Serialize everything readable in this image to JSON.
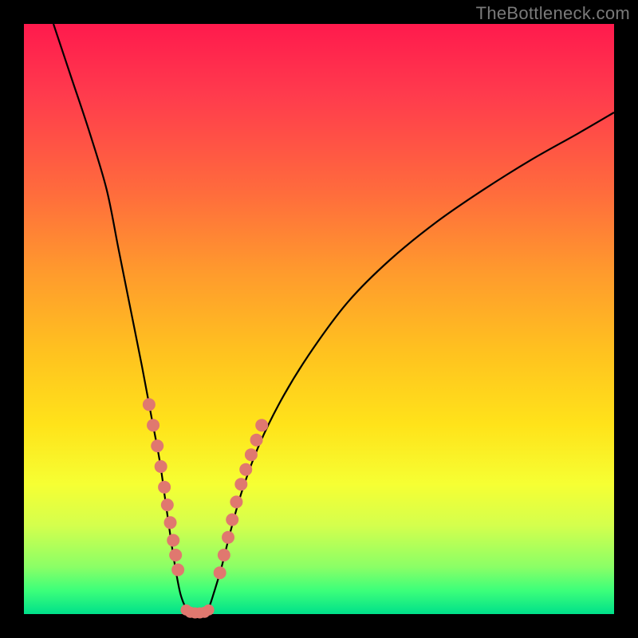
{
  "watermark": "TheBottleneck.com",
  "chart_data": {
    "type": "line",
    "title": "",
    "xlabel": "",
    "ylabel": "",
    "xlim": [
      0,
      100
    ],
    "ylim": [
      0,
      100
    ],
    "left_curve": {
      "x": [
        5,
        8,
        11,
        14,
        16,
        18,
        20,
        21.5,
        23,
        24,
        25,
        25.8,
        26.5,
        27.2,
        28
      ],
      "y": [
        100,
        91,
        82,
        72,
        62,
        52,
        42,
        34,
        26,
        19,
        12,
        7,
        3.5,
        1.5,
        0
      ]
    },
    "right_curve": {
      "x": [
        31,
        32,
        33.5,
        35,
        37,
        40,
        44,
        49,
        55,
        62,
        70,
        78,
        86,
        94,
        100
      ],
      "y": [
        0,
        3,
        8,
        14,
        21,
        29,
        37,
        45,
        53,
        60,
        66.5,
        72,
        77,
        81.5,
        85
      ]
    },
    "markers_left": {
      "x": [
        21.2,
        21.9,
        22.6,
        23.2,
        23.8,
        24.3,
        24.8,
        25.3,
        25.7,
        26.1
      ],
      "y": [
        35.5,
        32,
        28.5,
        25,
        21.5,
        18.5,
        15.5,
        12.5,
        10,
        7.5
      ]
    },
    "markers_right": {
      "x": [
        33.2,
        33.9,
        34.6,
        35.3,
        36,
        36.8,
        37.6,
        38.5,
        39.4,
        40.3
      ],
      "y": [
        7,
        10,
        13,
        16,
        19,
        22,
        24.5,
        27,
        29.5,
        32
      ]
    },
    "markers_valley": {
      "x": [
        27.5,
        28.2,
        29,
        29.8,
        30.6,
        31.3
      ],
      "y": [
        0.7,
        0.3,
        0.2,
        0.2,
        0.3,
        0.7
      ]
    }
  }
}
